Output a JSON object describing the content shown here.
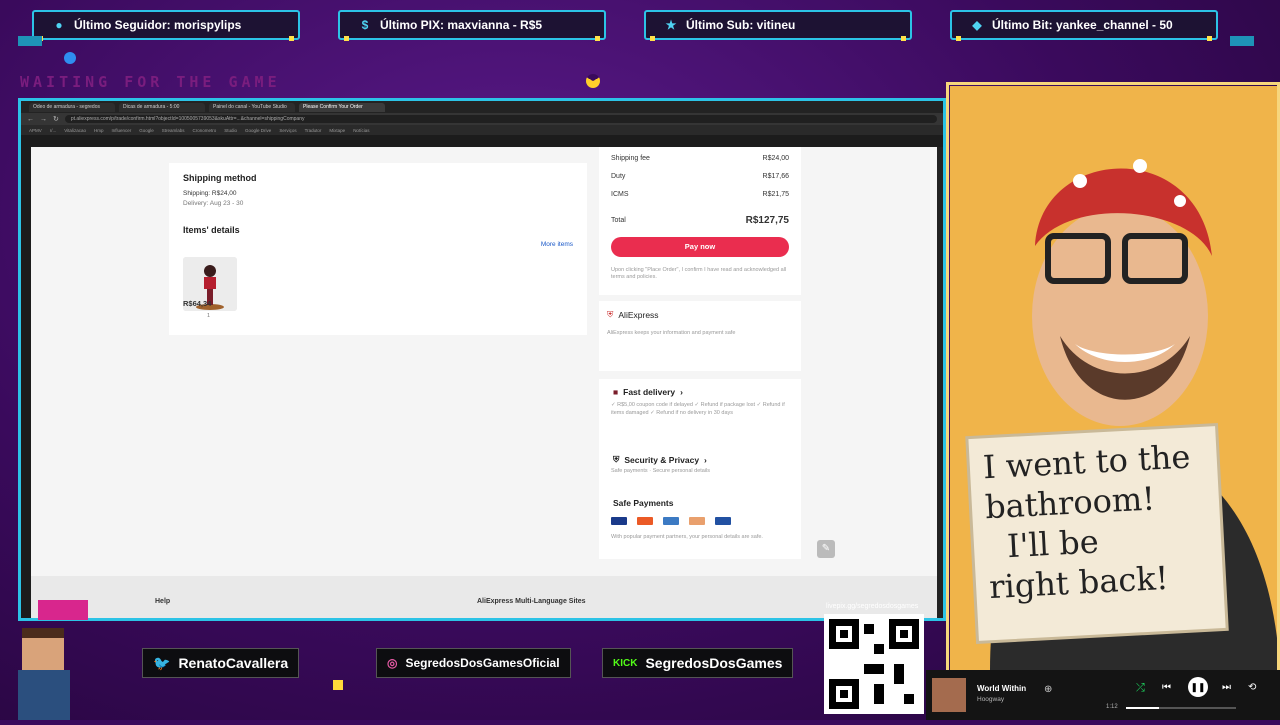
{
  "overlay": {
    "alerts": [
      {
        "label": "Último Seguidor: morispylips",
        "icon": "user-icon"
      },
      {
        "label": "Último PIX: maxvianna - R$5",
        "icon": "dollar-icon"
      },
      {
        "label": "Último Sub: vitineu",
        "icon": "star-icon"
      },
      {
        "label": "Último Bit: yankee_channel - 50",
        "icon": "diamond-icon"
      }
    ],
    "waiting_text": "WAITING FOR THE GAME",
    "socials": [
      {
        "label": "RenatoCavallera",
        "icon": "twitter-icon"
      },
      {
        "label": "SegredosDosGamesOficial",
        "icon": "instagram-icon"
      },
      {
        "label": "SegredosDosGames",
        "icon": "kick-icon",
        "badge": "KICK"
      }
    ],
    "qr_caption": "livepix.gg/segredosdosgames",
    "sign": [
      "I went to the",
      "bathroom!",
      "I'll be",
      "right back!"
    ],
    "colors": {
      "frame": "#2cc3e6",
      "bg": "#3a0a5c",
      "accent": "#ffe24a"
    }
  },
  "music": {
    "title": "World Within",
    "artist": "Hoogway",
    "elapsed": "1:12",
    "progress": 0.3
  },
  "browser": {
    "tabs": [
      {
        "label": "Odeo de armadura - segredos"
      },
      {
        "label": "Dicas de armadura - 5:00"
      },
      {
        "label": "Painel do canal - YouTube Studio"
      },
      {
        "label": "Please Confirm Your Order",
        "active": true
      }
    ],
    "url": "pt.aliexpress.com/p/trade/confirm.html?objectId=1005005739053&skuAttr=...&channel=shippingCompany",
    "bookmarks": [
      "APMV",
      "r/...",
      "Vitalizacao",
      "Hmp",
      "Influencer",
      "Google",
      "Streamlabs",
      "Cronometro",
      "Studio",
      "Google Drive",
      "Serviços",
      "Tradutor",
      "Mixtape",
      "Notícias"
    ]
  },
  "checkout": {
    "shipping_method": {
      "title": "Shipping method",
      "shipping": "Shipping: R$24,00",
      "delivery": "Delivery: Aug 23 - 30"
    },
    "items": {
      "title": "Items' details",
      "more": "More items",
      "price": "R$64,34",
      "qty": "1"
    },
    "summary": {
      "rows": [
        {
          "label": "Shipping fee",
          "value": "R$24,00"
        },
        {
          "label": "Duty",
          "value": "R$17,66"
        },
        {
          "label": "ICMS",
          "value": "R$21,75"
        }
      ],
      "total_label": "Total",
      "total_value": "R$127,75",
      "pay_button": "Pay now",
      "legal": "Upon clicking \"Place Order\", I confirm I have read and acknowledged all terms and policies."
    },
    "aliexpress": {
      "title": "AliExpress",
      "desc": "AliExpress keeps your information and payment safe"
    },
    "features": [
      {
        "title": "Fast delivery",
        "desc": "✓ R$5,00 coupon code if delayed  ✓ Refund if package lost  ✓ Refund if items damaged  ✓ Refund if no delivery in 30 days",
        "icon": "box-icon"
      },
      {
        "title": "Security & Privacy",
        "desc": "Safe payments · Secure personal details",
        "icon": "shield-icon"
      },
      {
        "title": "Safe Payments",
        "desc": "With popular payment partners, your personal details are safe.",
        "icon": "lock-icon"
      }
    ],
    "footer": {
      "help": "Help",
      "multi": "AliExpress Multi-Language Sites"
    }
  }
}
